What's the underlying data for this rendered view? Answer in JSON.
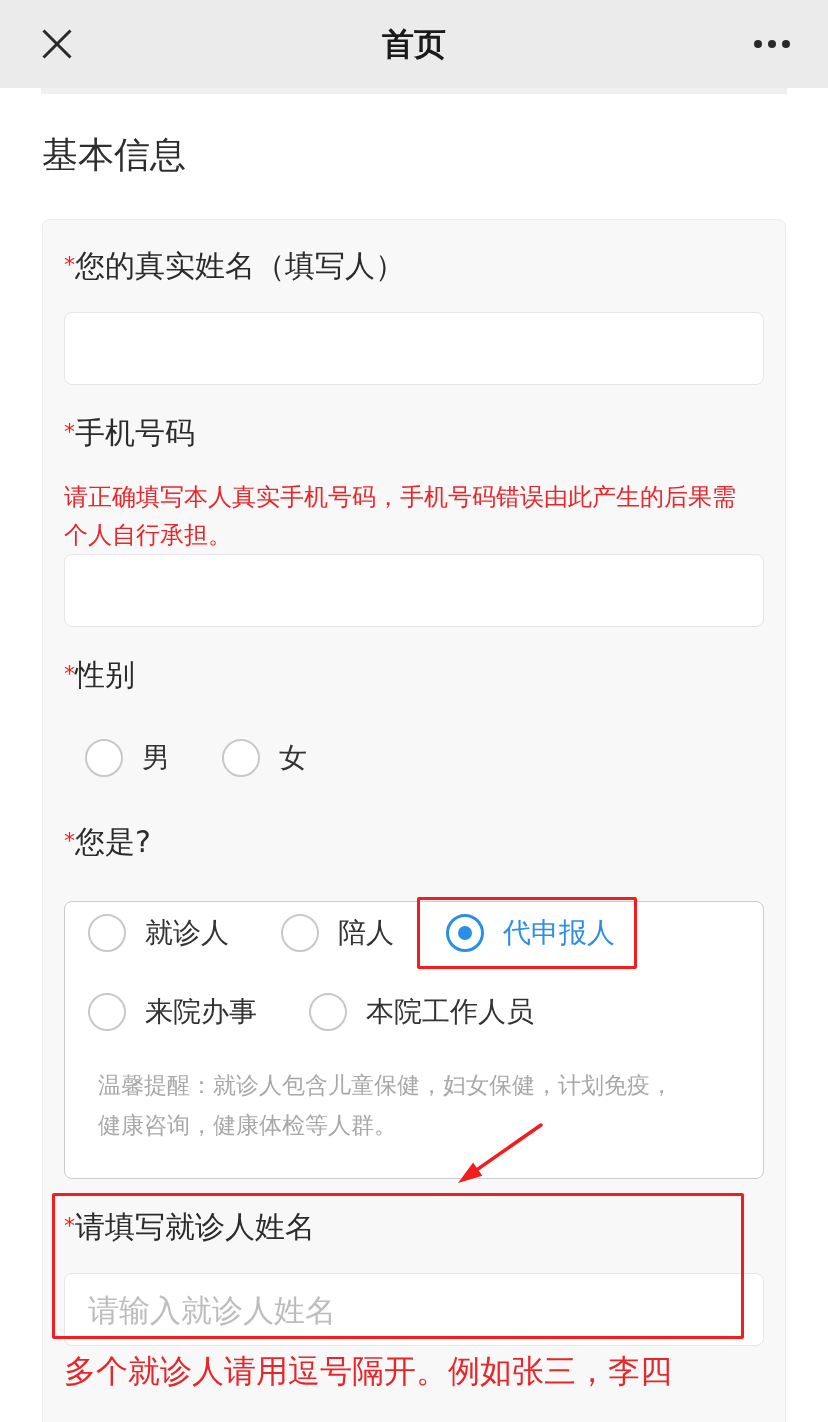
{
  "top_bar": {
    "title": "首页"
  },
  "section_title": "基本信息",
  "fields": [
    {
      "kind": "text",
      "marker": "*",
      "label": "您的真实姓名（填写人）",
      "highlighted": false
    },
    {
      "kind": "text",
      "marker": "*",
      "label": "手机号码",
      "note": "请正确填写本人真实手机号码，手机号码错误由此产生的后果需个人自行承担。",
      "highlighted": false
    },
    {
      "kind": "radio",
      "marker": "*",
      "label": "性别",
      "options": [
        {
          "label": "男",
          "selected": false,
          "highlighted": false
        },
        {
          "label": "女",
          "selected": false,
          "highlighted": false
        }
      ],
      "highlighted": false
    },
    {
      "kind": "radio_panel",
      "marker": "*",
      "label": "您是?",
      "options": [
        {
          "label": "就诊人",
          "selected": false,
          "highlighted": false
        },
        {
          "label": "陪人",
          "selected": false,
          "highlighted": false
        },
        {
          "label": "代申报人",
          "selected": true,
          "highlighted": true
        },
        {
          "label": "来院办事",
          "selected": false,
          "highlighted": false
        },
        {
          "label": "本院工作人员",
          "selected": false,
          "highlighted": false
        }
      ],
      "tip": "温馨提醒：就诊人包含儿童保健，妇女保健，计划免疫，健康咨询，健康体检等人群。",
      "highlighted": false
    },
    {
      "kind": "text",
      "marker": "*",
      "label": "请填写就诊人姓名",
      "placeholder": "请输入就诊人姓名",
      "hint": "多个就诊人请用逗号隔开。例如张三，李四",
      "highlighted": true
    }
  ]
}
